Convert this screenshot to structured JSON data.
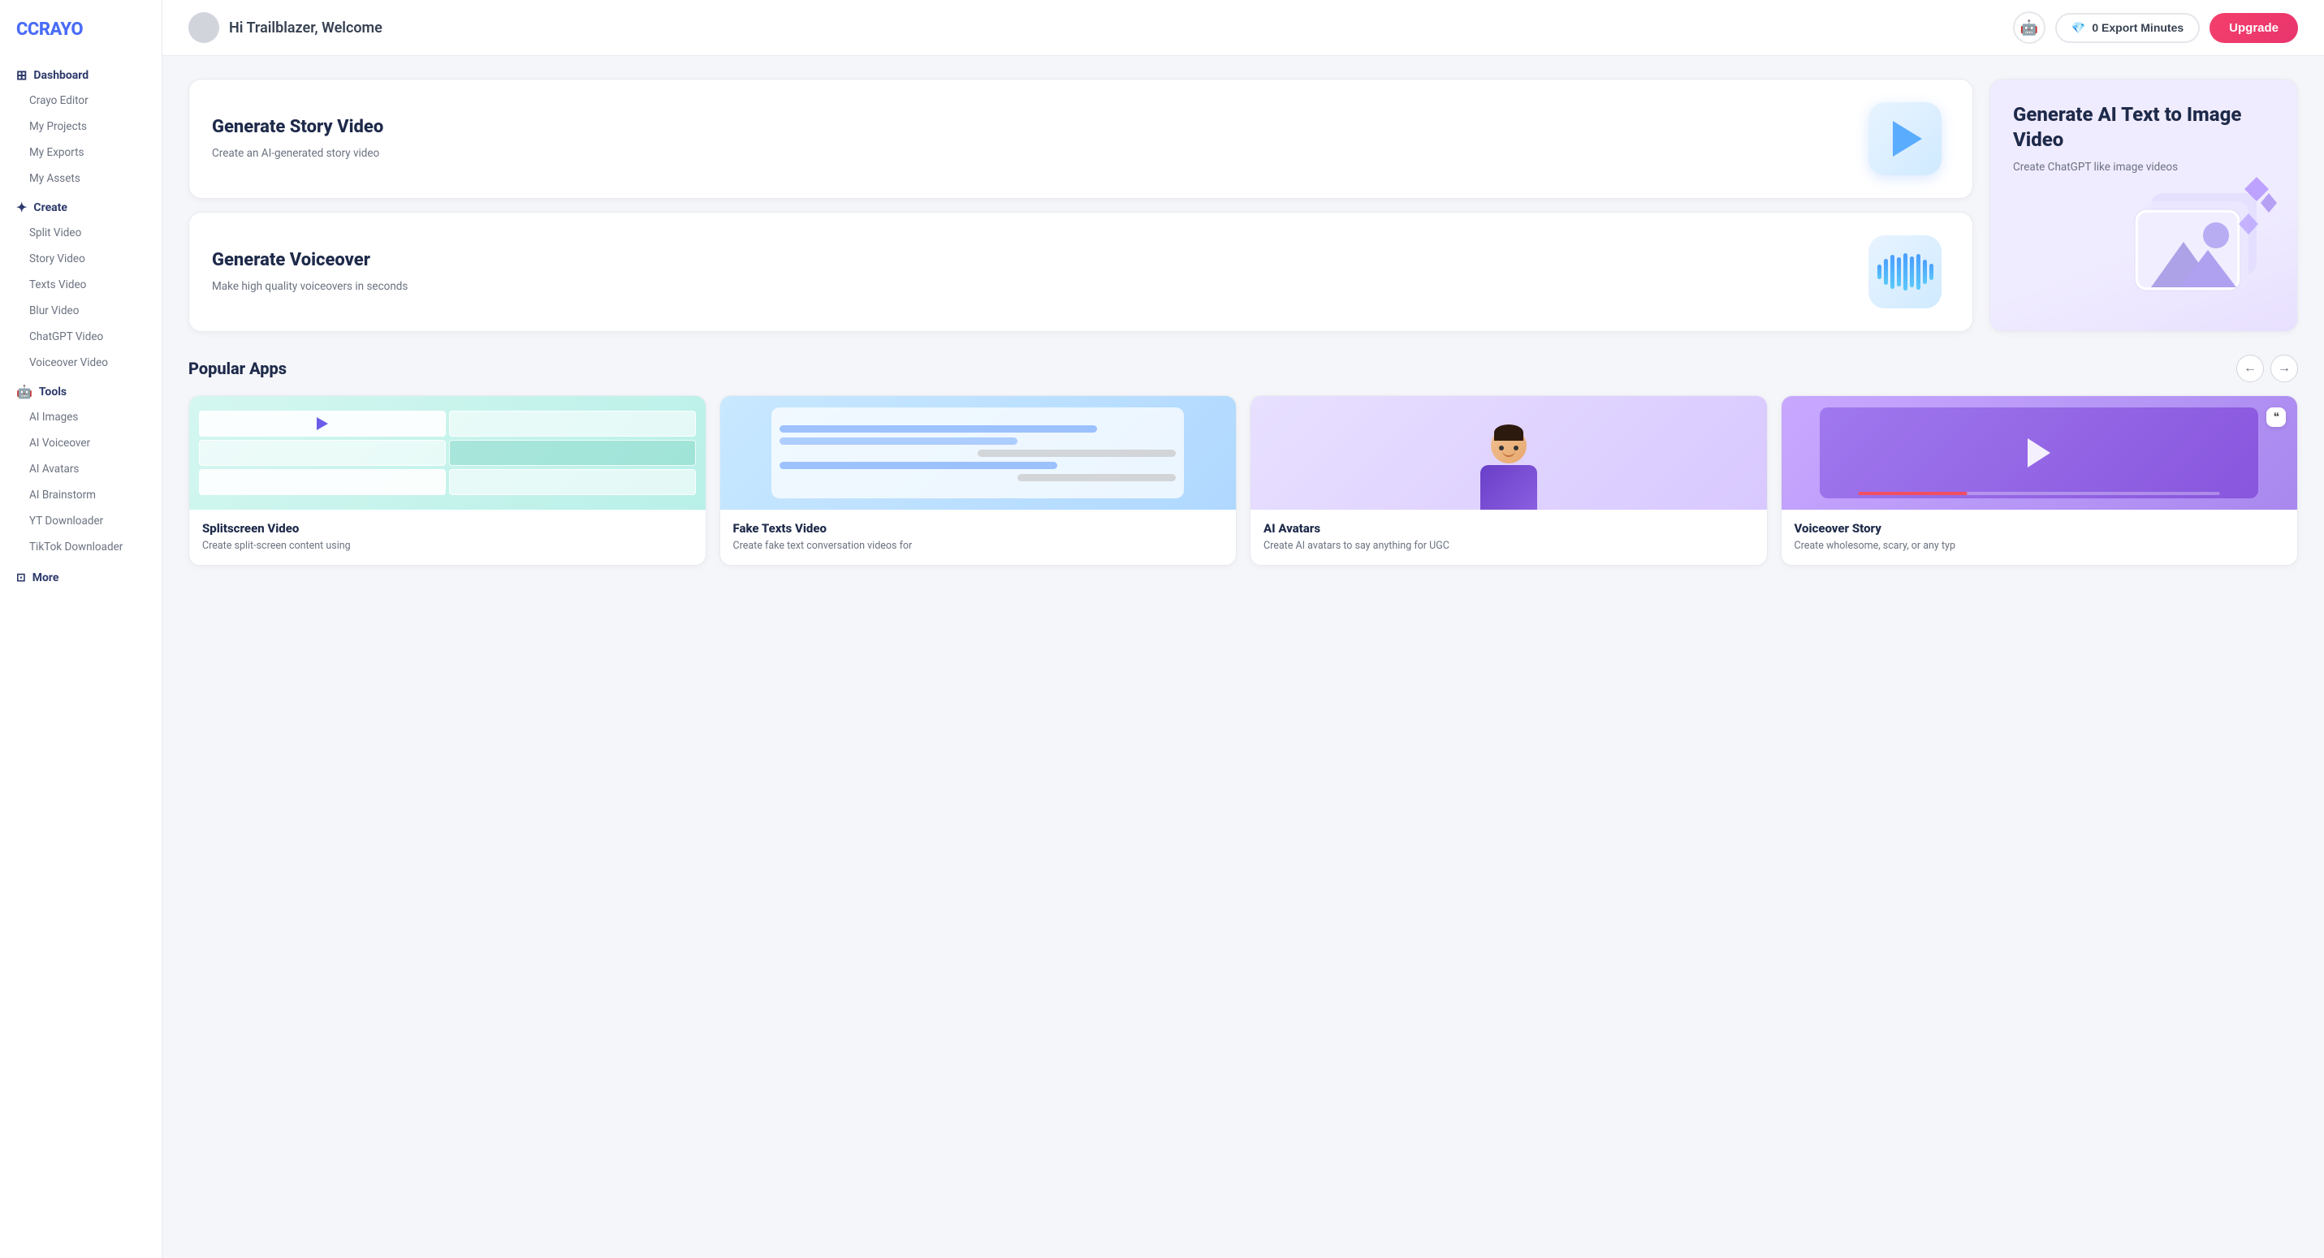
{
  "logo": {
    "text_crayo": "CRAYO"
  },
  "sidebar": {
    "dashboard_label": "Dashboard",
    "items_dashboard": [
      {
        "label": "Crayo Editor",
        "id": "crayo-editor"
      },
      {
        "label": "My Projects",
        "id": "my-projects"
      },
      {
        "label": "My Exports",
        "id": "my-exports"
      },
      {
        "label": "My Assets",
        "id": "my-assets"
      }
    ],
    "create_label": "Create",
    "items_create": [
      {
        "label": "Split Video",
        "id": "split-video"
      },
      {
        "label": "Story Video",
        "id": "story-video"
      },
      {
        "label": "Texts Video",
        "id": "texts-video"
      },
      {
        "label": "Blur Video",
        "id": "blur-video"
      },
      {
        "label": "ChatGPT Video",
        "id": "chatgpt-video"
      },
      {
        "label": "Voiceover Video",
        "id": "voiceover-video"
      }
    ],
    "tools_label": "Tools",
    "items_tools": [
      {
        "label": "AI Images",
        "id": "ai-images"
      },
      {
        "label": "AI Voiceover",
        "id": "ai-voiceover"
      },
      {
        "label": "AI Avatars",
        "id": "ai-avatars"
      },
      {
        "label": "AI Brainstorm",
        "id": "ai-brainstorm"
      },
      {
        "label": "YT Downloader",
        "id": "yt-downloader"
      },
      {
        "label": "TikTok Downloader",
        "id": "tiktok-downloader"
      }
    ],
    "more_label": "More"
  },
  "header": {
    "welcome_text": "Hi Trailblazer, Welcome",
    "export_minutes_label": "0 Export Minutes",
    "upgrade_label": "Upgrade"
  },
  "generate_cards": [
    {
      "id": "story-video",
      "title": "Generate Story Video",
      "desc": "Create an AI-generated story video"
    },
    {
      "id": "ai-text-image",
      "title": "Generate AI Text to Image Video",
      "desc": "Create ChatGPT like image videos"
    },
    {
      "id": "voiceover",
      "title": "Generate Voiceover",
      "desc": "Make high quality voiceovers in seconds"
    }
  ],
  "popular_section": {
    "title": "Popular Apps",
    "apps": [
      {
        "id": "splitscreen",
        "title": "Splitscreen Video",
        "desc": "Create split-screen content using"
      },
      {
        "id": "fake-texts",
        "title": "Fake Texts Video",
        "desc": "Create fake text conversation videos for"
      },
      {
        "id": "ai-avatars",
        "title": "AI Avatars",
        "desc": "Create AI avatars to say anything for UGC"
      },
      {
        "id": "voiceover-story",
        "title": "Voiceover Story",
        "desc": "Create wholesome, scary, or any typ"
      }
    ]
  },
  "icons": {
    "dashboard": "⊞",
    "create": "✦",
    "tools": "🤖",
    "more": "⊡",
    "ai_assistant": "🤖",
    "diamond": "💎",
    "arrow_left": "←",
    "arrow_right": "→"
  }
}
